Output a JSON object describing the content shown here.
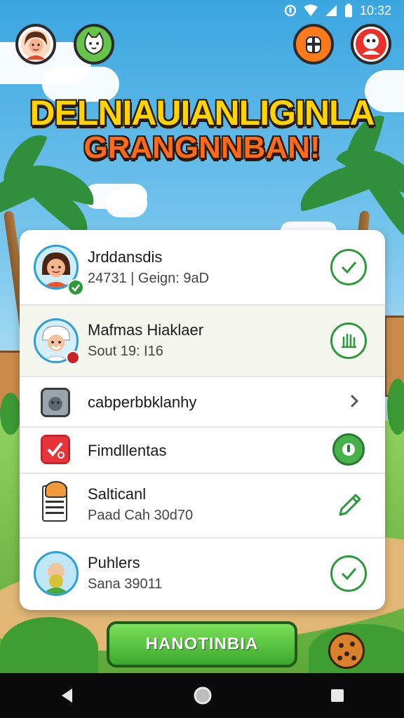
{
  "status_bar": {
    "time": "10:32"
  },
  "header": {
    "title_line1": "DELNIAUIANLIGINLA",
    "title_line2": "GRANGNNBAN!"
  },
  "list": [
    {
      "title": "Jrddansdis",
      "subtitle": "24731 | Geign: 9aD",
      "action_icon": "check-icon"
    },
    {
      "title": "Mafmas Hiaklaer",
      "subtitle": "Sout 19: I16",
      "action_icon": "hand-icon"
    },
    {
      "title": "cabperbbklanhy",
      "action_icon": "chevron-right-icon"
    },
    {
      "title": "Fimdllentas",
      "action_icon": "toggle-power-icon"
    },
    {
      "title": "Salticanl",
      "subtitle": "Paad Cah 30d70",
      "action_icon": "pencil-icon"
    },
    {
      "title": "Puhlers",
      "subtitle": "Sana 39011",
      "action_icon": "check-icon"
    }
  ],
  "primary_button": {
    "label": "HANOTINBIA"
  },
  "colors": {
    "accent_green": "#2c9a3a",
    "title_yellow": "#ffd400",
    "title_orange": "#ff6a1a",
    "avatar_ring": "#2aa0d8"
  }
}
